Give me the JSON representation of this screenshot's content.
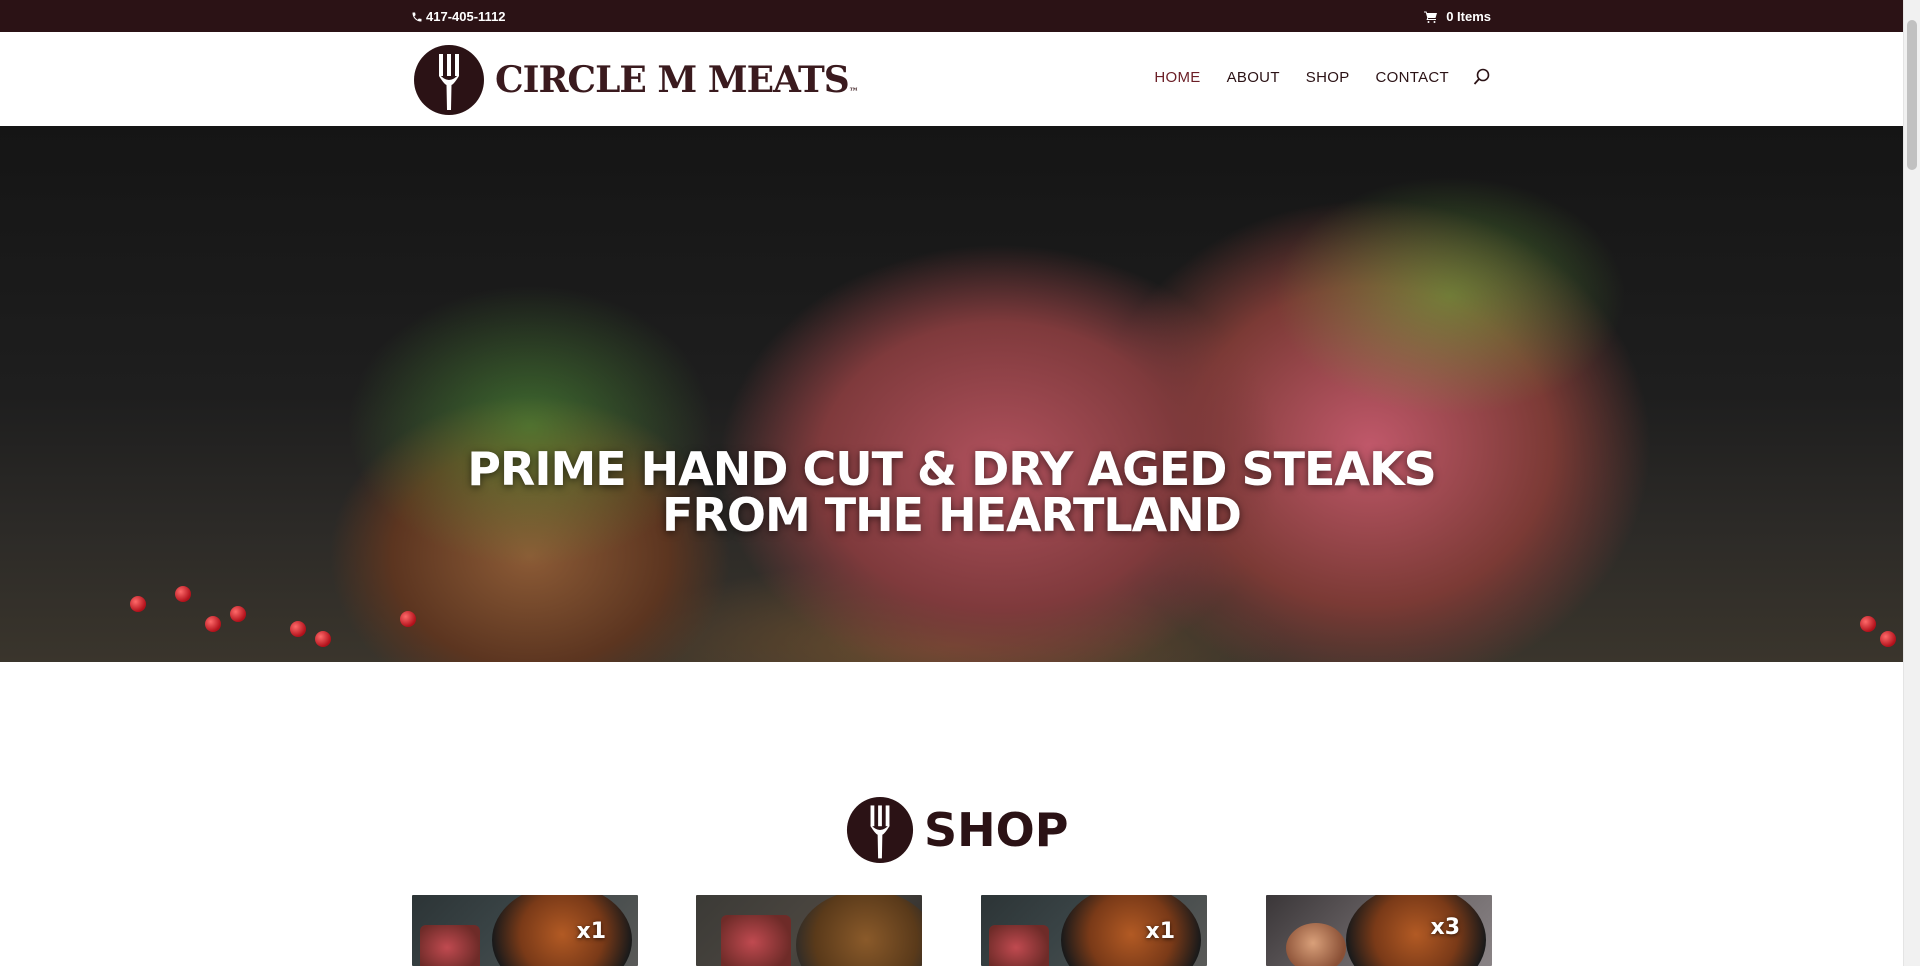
{
  "topbar": {
    "phone": "417-405-1112",
    "cart_label": "0 Items"
  },
  "brand": {
    "name": "CIRCLE M MEATS",
    "tm": "™",
    "color": "#2b1215",
    "accent": "#6b1e26"
  },
  "nav": {
    "items": [
      {
        "label": "HOME",
        "active": true
      },
      {
        "label": "ABOUT",
        "active": false
      },
      {
        "label": "SHOP",
        "active": false
      },
      {
        "label": "CONTACT",
        "active": false
      }
    ]
  },
  "hero": {
    "title_line1": "PRIME HAND CUT & DRY AGED STEAKS",
    "title_line2": "FROM THE HEARTLAND"
  },
  "shop": {
    "heading": "SHOP",
    "products": [
      {
        "badge": "x1"
      },
      {
        "badge": ""
      },
      {
        "badge": "x1"
      },
      {
        "badge": "x3"
      }
    ]
  },
  "icons": [
    "phone-icon",
    "cart-icon",
    "fork-logo-icon",
    "search-icon"
  ]
}
